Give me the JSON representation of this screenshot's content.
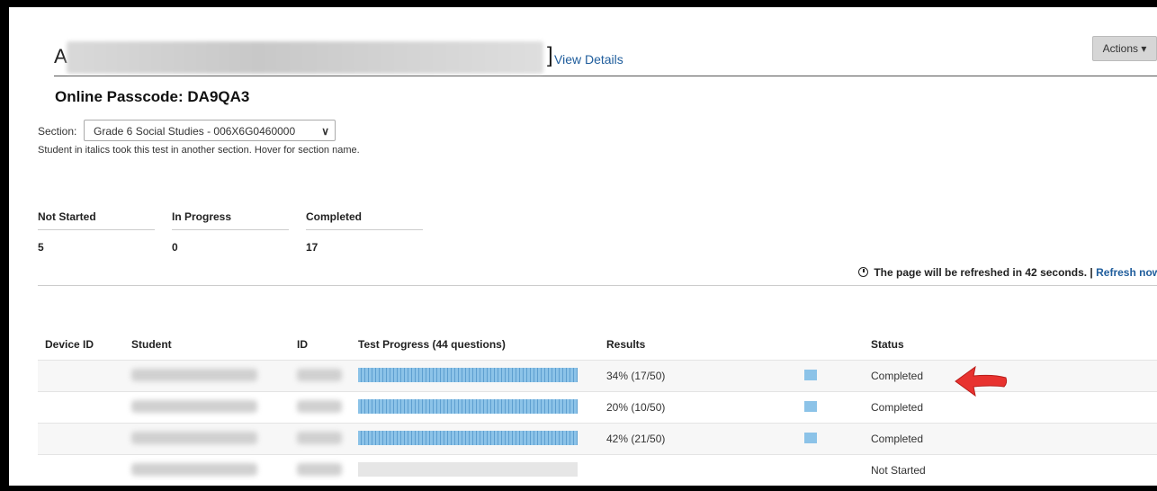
{
  "header": {
    "title_initial": "A",
    "title_bracket": "]",
    "view_details_label": "View Details",
    "actions_label": "Actions ▾"
  },
  "passcode": {
    "label": "Online Passcode:",
    "value": "DA9QA3"
  },
  "section": {
    "label": "Section:",
    "selected": "Grade 6 Social Studies - 006X6G0460000",
    "note": "Student in italics took this test in another section. Hover for section name."
  },
  "stats": [
    {
      "label": "Not Started",
      "value": "5"
    },
    {
      "label": "In Progress",
      "value": "0"
    },
    {
      "label": "Completed",
      "value": "17"
    }
  ],
  "refresh": {
    "message": "The page will be refreshed in 42 seconds. |",
    "link": "Refresh now"
  },
  "table": {
    "columns": [
      "Device ID",
      "Student",
      "ID",
      "Test Progress (44 questions)",
      "Results",
      "Status"
    ],
    "rows": [
      {
        "device_id": "",
        "progress": 1.0,
        "results": "34% (17/50)",
        "status": "Completed",
        "swatch": true
      },
      {
        "device_id": "",
        "progress": 1.0,
        "results": "20% (10/50)",
        "status": "Completed",
        "swatch": true
      },
      {
        "device_id": "",
        "progress": 1.0,
        "results": "42% (21/50)",
        "status": "Completed",
        "swatch": true
      },
      {
        "device_id": "",
        "progress": 0.0,
        "results": "",
        "status": "Not Started",
        "swatch": false
      }
    ]
  },
  "colors": {
    "link": "#1f5d9c",
    "progress": "#8cc3e8",
    "arrow": "#e8322f"
  }
}
